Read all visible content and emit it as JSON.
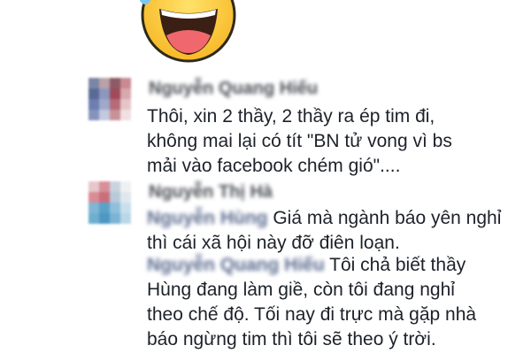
{
  "sticker": {
    "icon": "laughing-face-sticker"
  },
  "comments": [
    {
      "author_blurred": "Nguyễn Quang Hiếu",
      "text_lines": [
        "Thôi, xin 2 thầy, 2 thầy ra ép tim đi,",
        "không mai lại có tít \"BN tử vong vì bs",
        "mải vào facebook chém gió\"...."
      ]
    },
    {
      "author_blurred": "Nguyễn Thị Hà",
      "replies": [
        {
          "mention_blurred": "Nguyễn Hùng",
          "text_lines": [
            "Giá mà ngành báo yên nghỉ",
            "thì cái xã hội này đỡ điên loạn."
          ]
        },
        {
          "mention_blurred": "Nguyễn Quang Hiếu",
          "text_lines": [
            "Tôi chả biết thầy",
            "Hùng đang làm giề, còn tôi đang nghỉ",
            "theo chế độ. Tối nay đi trực mà gặp nhà",
            "báo ngừng tim thì tôi sẽ theo ý trời."
          ]
        }
      ]
    }
  ]
}
